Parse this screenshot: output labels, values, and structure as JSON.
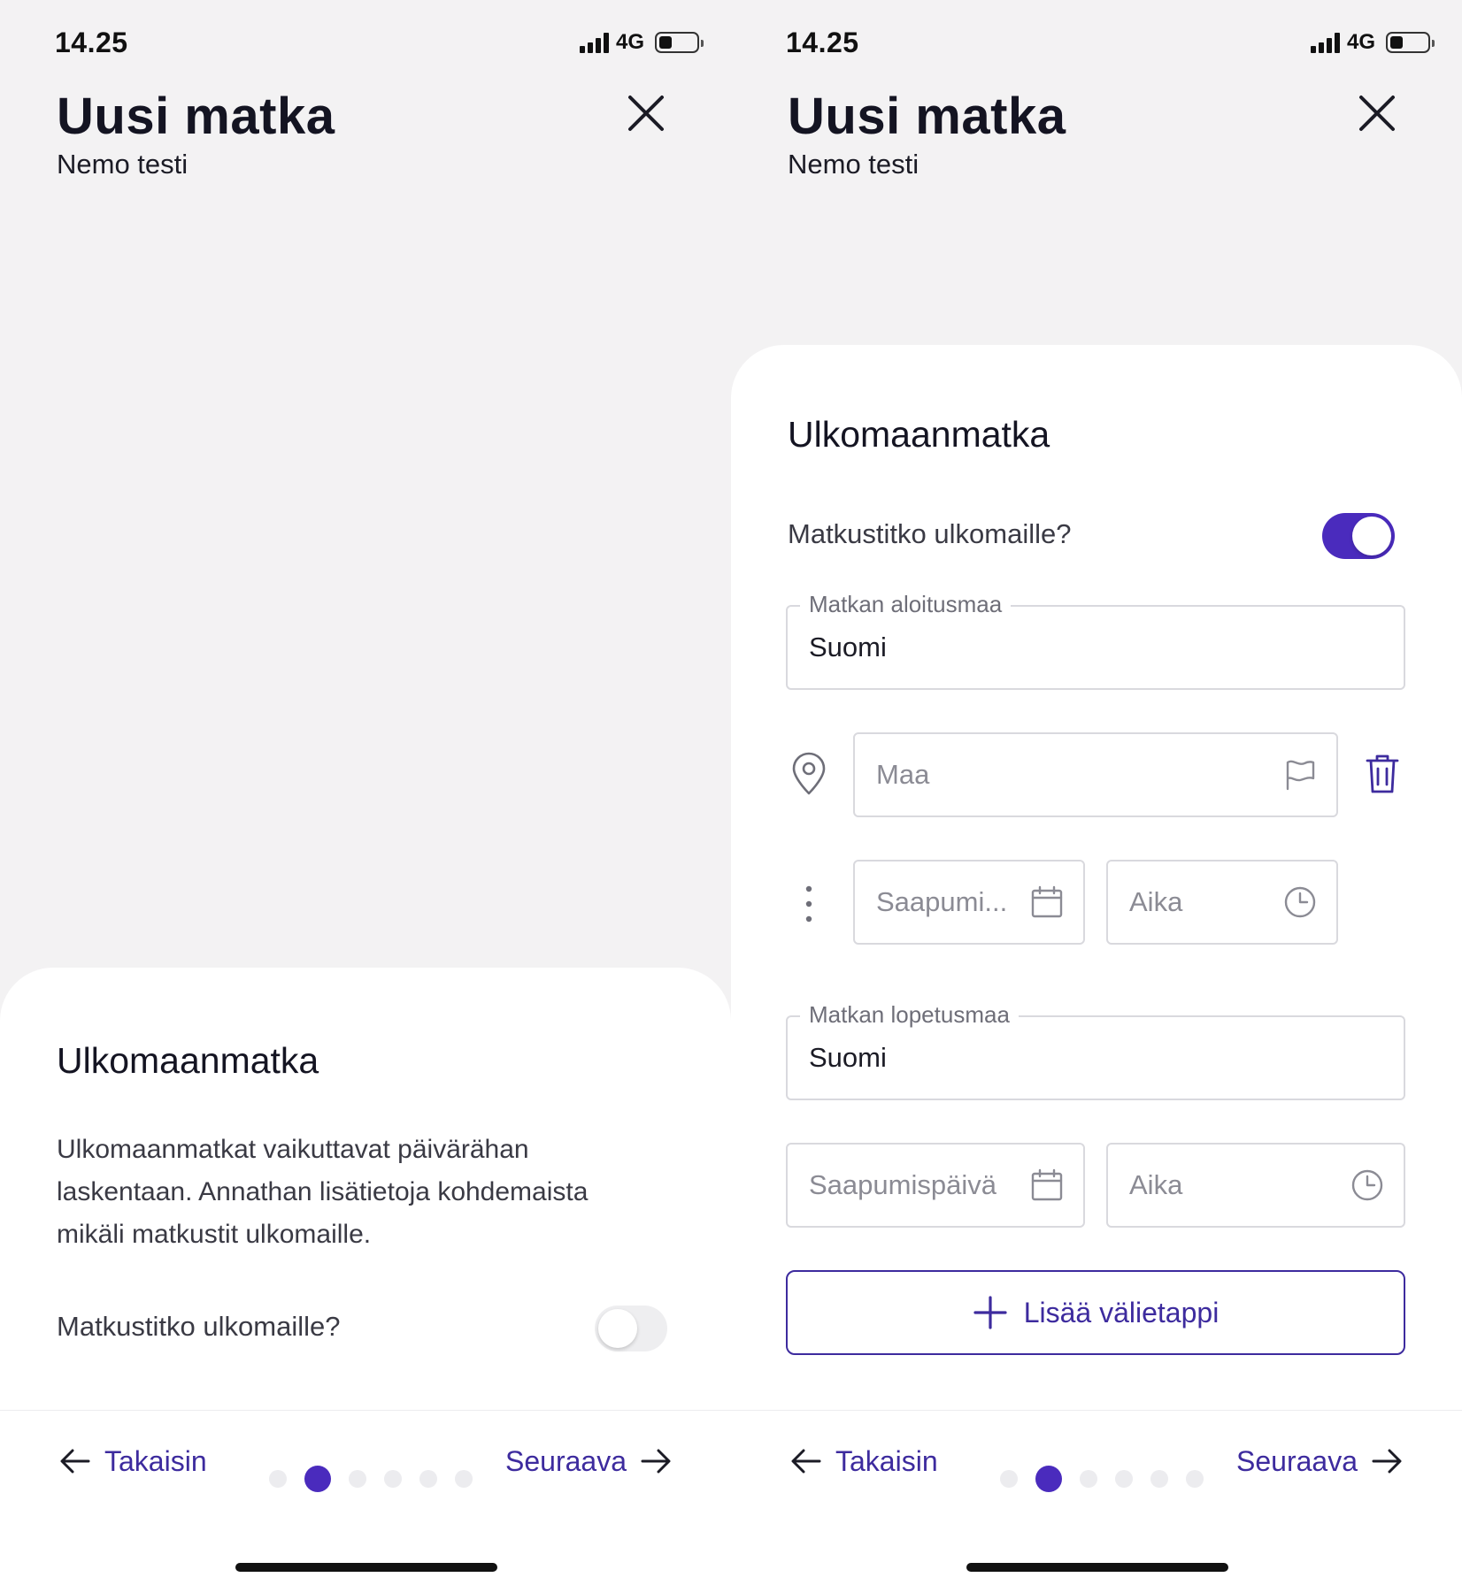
{
  "status": {
    "time": "14.25",
    "network": "4G"
  },
  "header": {
    "title": "Uusi matka",
    "subtitle": "Nemo testi"
  },
  "left": {
    "section_title": "Ulkomaanmatka",
    "info": "Ulkomaanmatkat vaikuttavat päivärähan laskentaan. Annathan lisätietoja kohdemaista mikäli matkustit ulkomaille.",
    "toggle_label": "Matkustitko ulkomaille?",
    "toggle_on": false
  },
  "right": {
    "section_title": "Ulkomaanmatka",
    "toggle_label": "Matkustitko ulkomaille?",
    "toggle_on": true,
    "start_country": {
      "label": "Matkan aloitusmaa",
      "value": "Suomi"
    },
    "stop": {
      "country_placeholder": "Maa",
      "date_placeholder": "Saapumi...",
      "time_placeholder": "Aika"
    },
    "end_country": {
      "label": "Matkan lopetusmaa",
      "value": "Suomi"
    },
    "end": {
      "date_placeholder": "Saapumispäivä",
      "time_placeholder": "Aika"
    },
    "add_stop_label": "Lisää välietappi"
  },
  "nav": {
    "back_label": "Takaisin",
    "next_label": "Seuraava",
    "step_count": 6,
    "current_step": 2
  },
  "colors": {
    "accent": "#4a2bbd",
    "link": "#3d2b9e",
    "background": "#f3f2f3"
  },
  "icons": [
    "signal-icon",
    "battery-icon",
    "close-icon",
    "location-pin-icon",
    "flag-icon",
    "trash-icon",
    "more-vertical-icon",
    "calendar-icon",
    "clock-icon",
    "plus-icon",
    "arrow-left-icon",
    "arrow-right-icon"
  ]
}
